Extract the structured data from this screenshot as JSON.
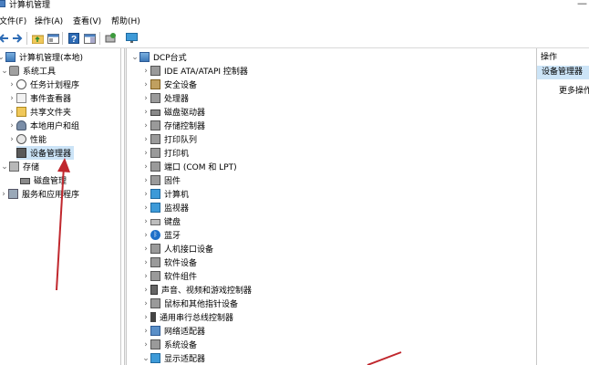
{
  "window": {
    "title": "计算机管理",
    "app_icon": "computer-management-icon"
  },
  "menu": [
    "文件(F)",
    "操作(A)",
    "查看(V)",
    "帮助(H)"
  ],
  "toolbar": [
    "back-icon",
    "forward-icon",
    "up-folder-icon",
    "properties-icon",
    "help-icon",
    "show-hide-icon",
    "scan-hardware-icon",
    "monitor-icon"
  ],
  "left_tree": [
    {
      "label": "计算机管理(本地)",
      "icon": "computer-icon",
      "expander": "⌄"
    },
    {
      "label": "系统工具",
      "icon": "tools-icon",
      "expander": "⌄"
    },
    {
      "label": "任务计划程序",
      "icon": "clock-icon",
      "expander": "›"
    },
    {
      "label": "事件查看器",
      "icon": "event-viewer-icon",
      "expander": "›"
    },
    {
      "label": "共享文件夹",
      "icon": "folder-icon",
      "expander": "›"
    },
    {
      "label": "本地用户和组",
      "icon": "users-icon",
      "expander": "›"
    },
    {
      "label": "性能",
      "icon": "performance-icon",
      "expander": "›"
    },
    {
      "label": "设备管理器",
      "icon": "device-manager-icon",
      "expander": "",
      "selected": true
    },
    {
      "label": "存储",
      "icon": "storage-icon",
      "expander": "⌄"
    },
    {
      "label": "磁盘管理",
      "icon": "disk-icon",
      "expander": ""
    },
    {
      "label": "服务和应用程序",
      "icon": "services-icon",
      "expander": "›"
    }
  ],
  "device_tree": {
    "root": "DCP台式",
    "categories": [
      {
        "label": "IDE ATA/ATAPI 控制器",
        "icon": "ide-icon"
      },
      {
        "label": "安全设备",
        "icon": "security-icon"
      },
      {
        "label": "处理器",
        "icon": "processor-icon"
      },
      {
        "label": "磁盘驱动器",
        "icon": "disk-drive-icon"
      },
      {
        "label": "存储控制器",
        "icon": "storage-controller-icon"
      },
      {
        "label": "打印队列",
        "icon": "print-queue-icon"
      },
      {
        "label": "打印机",
        "icon": "printer-icon"
      },
      {
        "label": "端口 (COM 和 LPT)",
        "icon": "port-icon"
      },
      {
        "label": "固件",
        "icon": "firmware-icon"
      },
      {
        "label": "计算机",
        "icon": "computer-icon"
      },
      {
        "label": "监视器",
        "icon": "monitor-icon"
      },
      {
        "label": "键盘",
        "icon": "keyboard-icon"
      },
      {
        "label": "蓝牙",
        "icon": "bluetooth-icon"
      },
      {
        "label": "人机接口设备",
        "icon": "hid-icon"
      },
      {
        "label": "软件设备",
        "icon": "software-device-icon"
      },
      {
        "label": "软件组件",
        "icon": "software-component-icon"
      },
      {
        "label": "声音、视频和游戏控制器",
        "icon": "audio-icon"
      },
      {
        "label": "鼠标和其他指针设备",
        "icon": "mouse-icon"
      },
      {
        "label": "通用串行总线控制器",
        "icon": "usb-icon"
      },
      {
        "label": "网络适配器",
        "icon": "network-adapter-icon"
      },
      {
        "label": "系统设备",
        "icon": "system-device-icon"
      },
      {
        "label": "显示适配器",
        "icon": "display-adapter-icon",
        "expanded": true
      }
    ]
  },
  "actions": {
    "header": "操作",
    "selected": "设备管理器",
    "more": "更多操作"
  },
  "colors": {
    "selection": "#cce4f7",
    "annotation_arrow": "#c0272d"
  }
}
